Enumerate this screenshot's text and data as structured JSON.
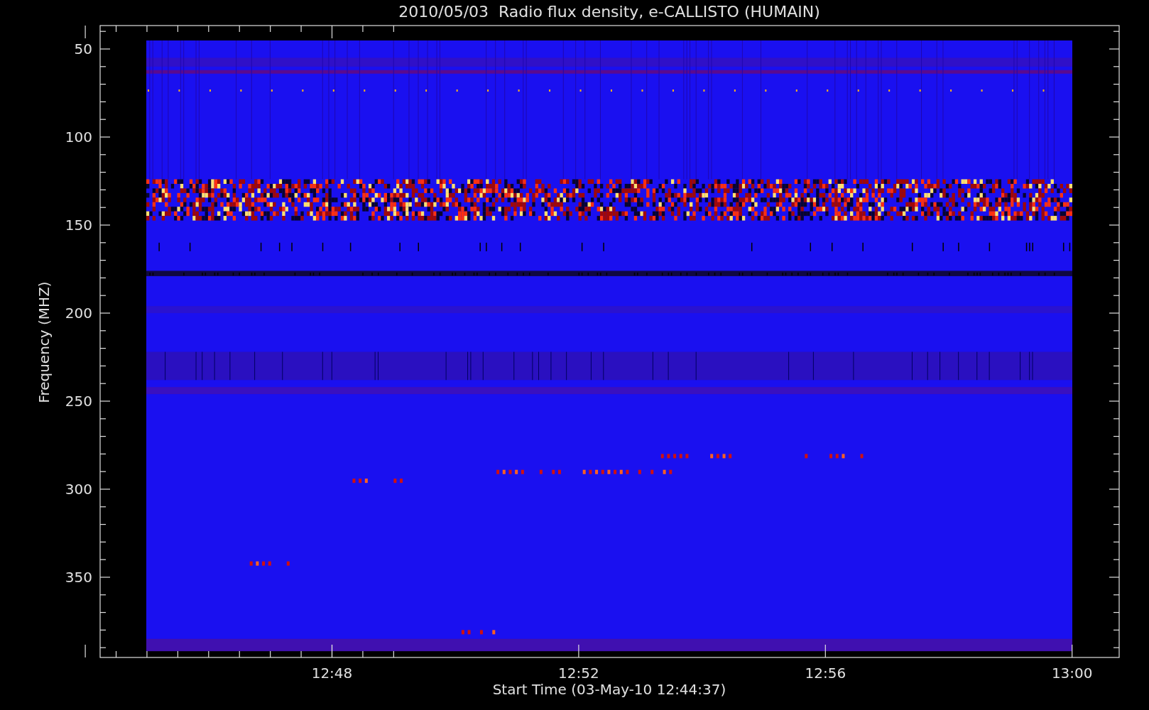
{
  "title": "2010/05/03  Radio flux density, e-CALLISTO (HUMAIN)",
  "y_axis": {
    "label": "Frequency (MHZ)",
    "ticks": [
      "50",
      "100",
      "150",
      "200",
      "250",
      "300",
      "350"
    ]
  },
  "x_axis": {
    "label": "Start Time (03-May-10 12:44:37)",
    "ticks": [
      "12:48",
      "12:52",
      "12:56",
      "13:00"
    ]
  }
}
